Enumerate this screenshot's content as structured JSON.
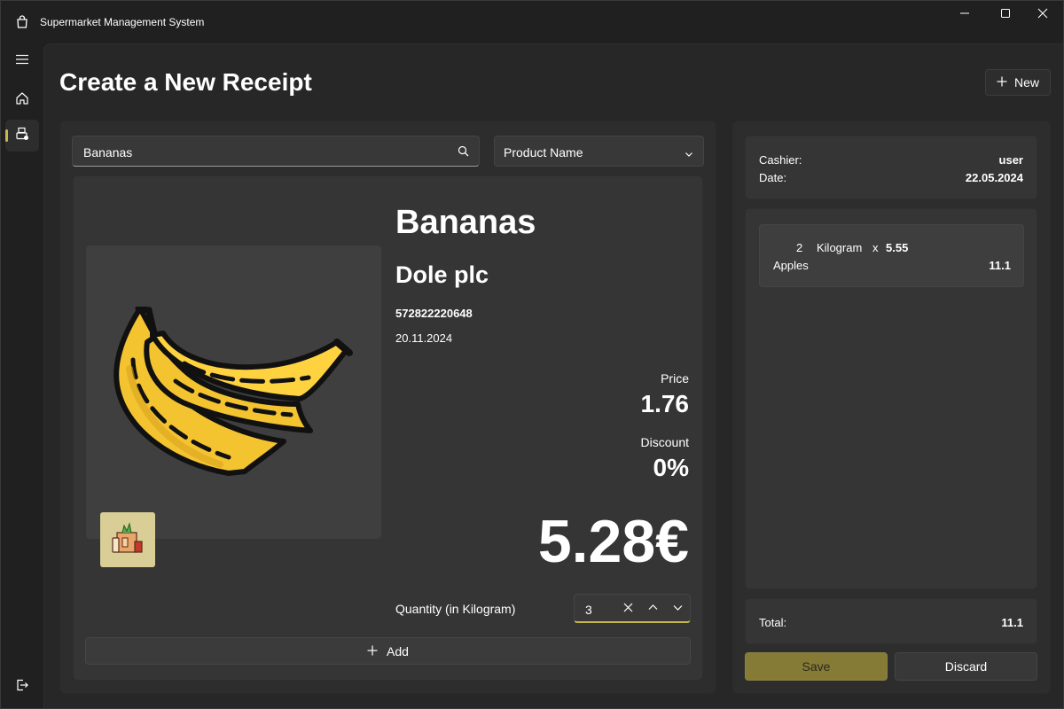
{
  "window": {
    "title": "Supermarket Management System",
    "icons": {
      "app": "shopping-bag-icon",
      "minimize": "minimize-icon",
      "maximize": "maximize-icon",
      "close": "close-icon"
    }
  },
  "nav": {
    "items": [
      {
        "name": "menu",
        "icon": "hamburger-menu-icon"
      },
      {
        "name": "home",
        "icon": "home-icon"
      },
      {
        "name": "receipt",
        "icon": "cash-register-icon",
        "selected": true
      },
      {
        "name": "logout",
        "icon": "sign-out-icon"
      }
    ]
  },
  "header": {
    "title": "Create a New Receipt",
    "new_button": "New"
  },
  "search": {
    "value": "Bananas",
    "filter_selected": "Product Name"
  },
  "product": {
    "name": "Bananas",
    "brand": "Dole plc",
    "barcode": "572822220648",
    "date": "20.11.2024",
    "price_label": "Price",
    "price": "1.76",
    "discount_label": "Discount",
    "discount": "0%",
    "total": "5.28€",
    "quantity_label": "Quantity (in Kilogram)",
    "quantity": "3",
    "add_button": "Add",
    "image_icon": "banana-icon",
    "category_icon": "grocery-bag-icon"
  },
  "receipt": {
    "cashier_label": "Cashier:",
    "cashier": "user",
    "date_label": "Date:",
    "date": "22.05.2024",
    "items": [
      {
        "quantity": "2",
        "unit": "Kilogram",
        "times": "x",
        "unit_price": "5.55",
        "name": "Apples",
        "line_total": "11.1"
      }
    ],
    "total_label": "Total:",
    "total": "11.1",
    "save_button": "Save",
    "discard_button": "Discard"
  },
  "colors": {
    "accent": "#c8b74a",
    "save_button_bg": "#857a36",
    "background": "#202020",
    "panel": "#2d2d2d",
    "card": "#353535"
  }
}
